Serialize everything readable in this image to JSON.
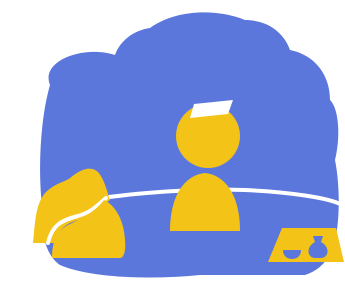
{
  "scene": {
    "description_icon": "meeting-illustration-icon",
    "colors": {
      "background": "#ffffff",
      "cloud": "#5b77dc",
      "figure": "#f3c318",
      "card": "#ffffff",
      "table_line": "#ffffff"
    }
  }
}
